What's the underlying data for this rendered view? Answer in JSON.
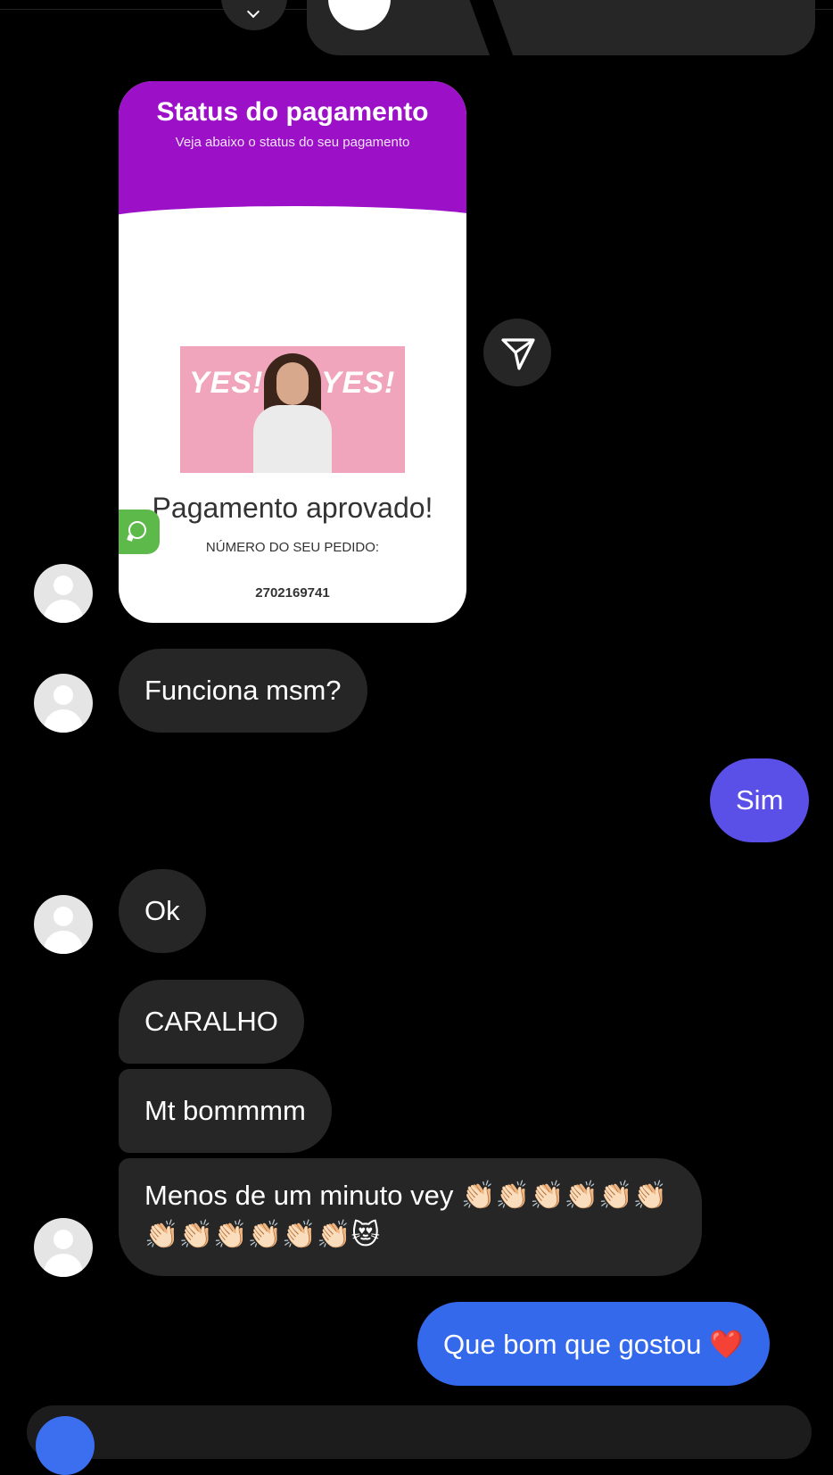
{
  "card": {
    "title": "Status do pagamento",
    "subtitle": "Veja abaixo o status do seu pagamento",
    "gif_text_left": "YES!",
    "gif_text_right": "YES!",
    "status": "Pagamento aprovado!",
    "order_label": "NÚMERO DO SEU PEDIDO:",
    "order_number": "2702169741",
    "header_color": "#9c10c8"
  },
  "messages": {
    "m1": "Funciona msm?",
    "m2": "Sim",
    "m3": "Ok",
    "m4": "CARALHO",
    "m5": "Mt bommmm",
    "m6": "Menos de um minuto vey 👏🏻👏🏻👏🏻👏🏻👏🏻👏🏻👏🏻👏🏻👏🏻👏🏻👏🏻👏🏻😻",
    "m7": "Que bom que gostou ❤️"
  },
  "colors": {
    "incoming_bubble": "#262626",
    "sim_bubble": "#5a4fe6",
    "outgoing_bubble": "#3369ea",
    "whatsapp": "#5eb94b"
  },
  "icons": {
    "share": "paper-plane-icon",
    "whatsapp": "whatsapp-icon",
    "avatar": "default-user-avatar"
  }
}
